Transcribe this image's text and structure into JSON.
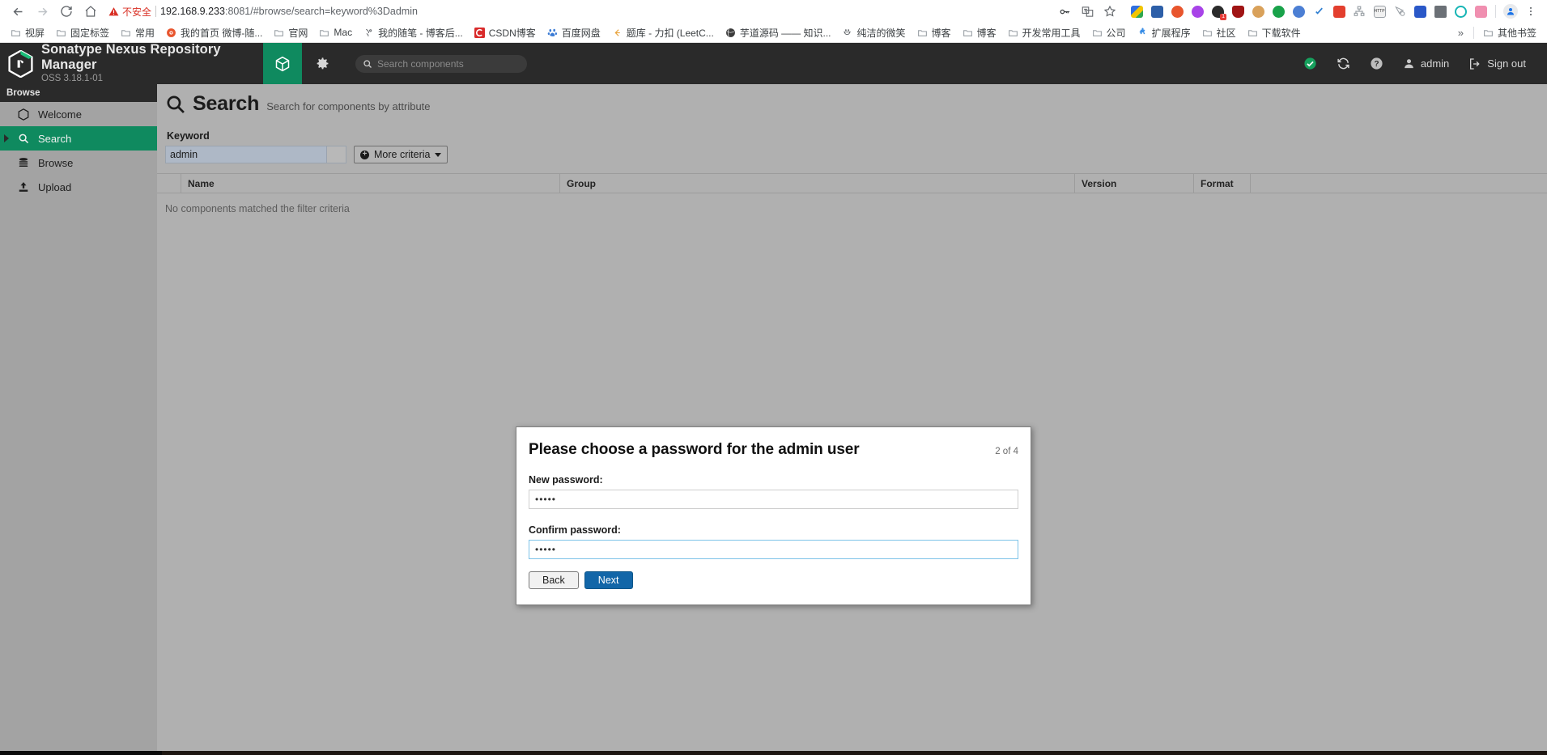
{
  "browser": {
    "nav": {
      "back_icon": "arrow-left-icon",
      "forward_icon": "arrow-right-icon",
      "reload_icon": "reload-icon",
      "home_icon": "home-icon"
    },
    "omnibox": {
      "security_label": "不安全",
      "security_icon": "warning-triangle-icon",
      "url_host": "192.168.9.233",
      "url_rest": ":8081/#browse/search=keyword%3Dadmin",
      "full_url": "192.168.9.233:8081/#browse/search=keyword%3Dadmin",
      "icons": [
        "key-icon",
        "translate-icon",
        "star-icon"
      ]
    },
    "extensions": [
      {
        "name": "ext-icon-zhihu",
        "color": "#3a7bd5"
      },
      {
        "name": "ext-icon-fe",
        "color": "#2d5fa8"
      },
      {
        "name": "ext-icon-weibo",
        "color": "#e8552d"
      },
      {
        "name": "ext-icon-purple",
        "color": "#a843e8"
      },
      {
        "name": "ext-icon-dark-badge",
        "color": "#2b2b2b",
        "badge": "1"
      },
      {
        "name": "ext-icon-ublock",
        "color": "#a01414"
      },
      {
        "name": "ext-icon-cookie",
        "color": "#d9a15a"
      },
      {
        "name": "ext-icon-c-green",
        "color": "#19a24a"
      },
      {
        "name": "ext-icon-yandex",
        "color": "#4c7fd4"
      },
      {
        "name": "ext-icon-blue-check",
        "color": "#2f7fd1"
      },
      {
        "name": "ext-icon-red-speech",
        "color": "#e33f2e"
      },
      {
        "name": "ext-icon-sitemap",
        "color": "#9aa0a6"
      },
      {
        "name": "ext-icon-http",
        "color": "#5f6368"
      },
      {
        "name": "ext-icon-cursor-block",
        "color": "#9aa0a6"
      },
      {
        "name": "ext-icon-qr",
        "color": "#2a58c8"
      },
      {
        "name": "ext-icon-monitor",
        "color": "#6b7076"
      },
      {
        "name": "ext-icon-t-circle",
        "color": "#17b5b5"
      },
      {
        "name": "ext-icon-pink-tv",
        "color": "#f08fb0"
      }
    ],
    "profile_icon": "profile-avatar-icon",
    "menu_icon": "kebab-menu-icon",
    "bookmarks": [
      {
        "label": "视屏",
        "icon": "folder-icon",
        "color": "#9aa0a6"
      },
      {
        "label": "固定标签",
        "icon": "folder-icon",
        "color": "#9aa0a6"
      },
      {
        "label": "常用",
        "icon": "folder-icon",
        "color": "#9aa0a6"
      },
      {
        "label": "我的首页 微博-随...",
        "icon": "weibo-icon",
        "color": "#e8552d"
      },
      {
        "label": "官网",
        "icon": "folder-icon",
        "color": "#9aa0a6"
      },
      {
        "label": "Mac",
        "icon": "folder-icon",
        "color": "#9aa0a6"
      },
      {
        "label": "我的随笔 - 博客后...",
        "icon": "cnblogs-icon",
        "color": "#5f6368"
      },
      {
        "label": "CSDN博客",
        "icon": "csdn-icon",
        "color": "#d92b2b"
      },
      {
        "label": "百度网盘",
        "icon": "baidu-icon",
        "color": "#3a7bd5"
      },
      {
        "label": "题库 - 力扣 (LeetC...",
        "icon": "leetcode-icon",
        "color": "#e8a33d"
      },
      {
        "label": "芋道源码 —— 知识...",
        "icon": "globe-dark-icon",
        "color": "#3b3b3b"
      },
      {
        "label": "纯洁的微笑",
        "icon": "smile-icon",
        "color": "#5f6368"
      },
      {
        "label": "博客",
        "icon": "folder-icon",
        "color": "#9aa0a6"
      },
      {
        "label": "博客",
        "icon": "folder-icon",
        "color": "#9aa0a6"
      },
      {
        "label": "开发常用工具",
        "icon": "folder-icon",
        "color": "#9aa0a6"
      },
      {
        "label": "公司",
        "icon": "folder-icon",
        "color": "#9aa0a6"
      },
      {
        "label": "扩展程序",
        "icon": "puzzle-icon",
        "color": "#3a8ee6"
      },
      {
        "label": "社区",
        "icon": "folder-icon",
        "color": "#9aa0a6"
      },
      {
        "label": "下载软件",
        "icon": "folder-icon",
        "color": "#9aa0a6"
      }
    ],
    "bookmarks_overflow": "»",
    "other_bookmarks": {
      "label": "其他书签",
      "icon": "folder-icon"
    }
  },
  "nexus": {
    "brand": {
      "title": "Sonatype Nexus Repository Manager",
      "version": "OSS 3.18.1-01",
      "logo_icon": "nexus-hex-logo-icon",
      "accent": "#0f8a5f"
    },
    "tabs": [
      {
        "name": "browse-tab",
        "icon": "cube-icon",
        "active": true
      },
      {
        "name": "admin-tab",
        "icon": "gear-icon",
        "active": false
      }
    ],
    "search": {
      "placeholder": "Search components",
      "icon": "search-icon",
      "value": ""
    },
    "header_right": {
      "health_icon": "check-circle-icon",
      "health_color": "#16a05d",
      "refresh_icon": "refresh-icon",
      "help_icon": "question-circle-icon",
      "user_icon": "user-icon",
      "user_label": "admin",
      "signout_icon": "sign-out-icon",
      "signout_label": "Sign out"
    },
    "sidebar": {
      "section_title": "Browse",
      "items": [
        {
          "label": "Welcome",
          "icon": "hexagon-icon",
          "active": false
        },
        {
          "label": "Search",
          "icon": "search-icon",
          "active": true
        },
        {
          "label": "Browse",
          "icon": "database-icon",
          "active": false
        },
        {
          "label": "Upload",
          "icon": "upload-icon",
          "active": false
        }
      ]
    },
    "page": {
      "title": "Search",
      "title_icon": "search-icon",
      "subtitle": "Search for components by attribute",
      "keyword_label": "Keyword",
      "keyword_value": "admin",
      "more_criteria_label": "More criteria",
      "more_criteria_icon": "plus-circle-icon",
      "table": {
        "columns": [
          "Name",
          "Group",
          "Version",
          "Format"
        ],
        "rows": [],
        "empty_message": "No components matched the filter criteria"
      }
    },
    "modal": {
      "title": "Please choose a password for the admin user",
      "step": "2 of 4",
      "new_password_label": "New password:",
      "new_password_value": "•••••",
      "confirm_password_label": "Confirm password:",
      "confirm_password_value": "•••••",
      "back_label": "Back",
      "next_label": "Next",
      "next_color": "#1266a8"
    }
  }
}
